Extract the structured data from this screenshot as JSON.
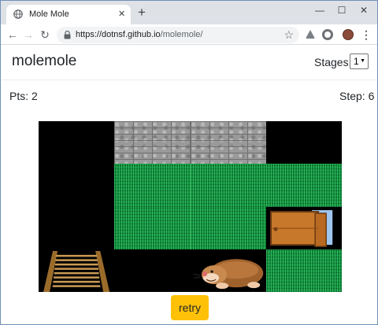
{
  "browser": {
    "tab_title": "Mole Mole",
    "tab_close": "✕",
    "new_tab": "+",
    "url_host": "https://dotnsf.github.io",
    "url_path": "/molemole/",
    "window_controls": {
      "minimize": "—",
      "maximize": "☐",
      "close": "✕"
    },
    "icons": [
      "globe-icon",
      "back-arrow-icon",
      "forward-arrow-icon",
      "reload-icon",
      "lock-icon",
      "star-icon",
      "drive-extension-icon",
      "circle-extension-icon",
      "avatar-icon",
      "menu-icon"
    ]
  },
  "app": {
    "title": "molemole",
    "stages_label": "Stages:",
    "stages_value": "1",
    "points": "Pts: 2",
    "step": "Step: 6",
    "retry_label": "retry"
  },
  "board": {
    "columns": 4,
    "rows": 4,
    "tiles": [
      [
        "black",
        "stone",
        "stone",
        "black"
      ],
      [
        "black",
        "grass",
        "grass",
        "grass"
      ],
      [
        "black",
        "grass",
        "grass",
        "door"
      ],
      [
        "ladder",
        "black",
        "mole",
        "grass"
      ]
    ],
    "colors": {
      "grass": "#0f8a3c",
      "stone": "#9a9a9a",
      "black": "#000000",
      "door": "#c8782a",
      "mole": "#a0622d",
      "ladder": "#9b6b2a"
    }
  }
}
